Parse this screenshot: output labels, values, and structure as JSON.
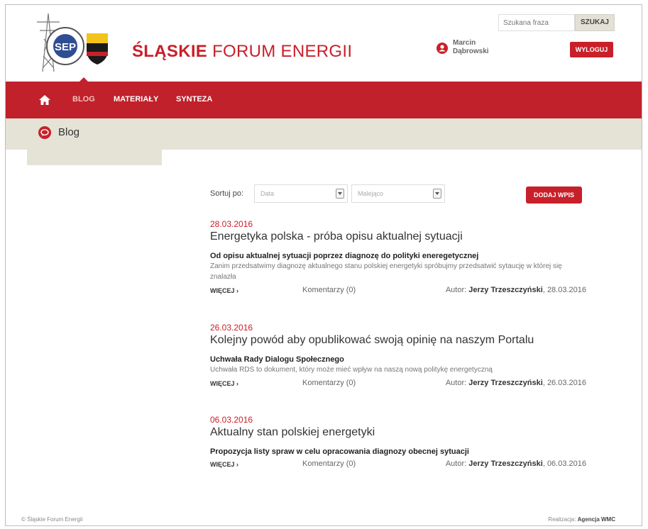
{
  "header": {
    "title_bold": "ŚLĄSKIE",
    "title_rest": " FORUM ENERGII",
    "search_placeholder": "Szukana fraza",
    "search_button": "SZUKAJ",
    "user_first": "Marcin",
    "user_last": "Dąbrowski",
    "logout_button": "WYLOGUJ"
  },
  "nav": {
    "home_icon": "home-icon",
    "items": [
      {
        "label": "BLOG"
      },
      {
        "label": "MATERIAŁY"
      },
      {
        "label": "SYNTEZA"
      }
    ]
  },
  "breadcrumb": {
    "title": "Blog",
    "icon": "speech-bubble-icon"
  },
  "sort": {
    "label": "Sortuj po:",
    "field_value": "Data",
    "order_value": "Malejąco",
    "add_button": "DODAJ WPIS"
  },
  "posts": [
    {
      "date": "28.03.2016",
      "title": "Energetyka polska - próba opisu aktualnej sytuacji",
      "subtitle": "Od opisu aktualnej sytuacji poprzez diagnozę do polityki eneregetycznej",
      "excerpt": "Zanim przedsatwimy diagnozę aktualnego stanu polskiej energetyki spróbujmy przedsatwić sytaucję w której się znalazła",
      "more": "WIĘCEJ ›",
      "comments": "Komentarzy (0)",
      "author_label": "Autor: ",
      "author_name": "Jerzy Trzeszczyński",
      "author_date": ", 28.03.2016"
    },
    {
      "date": "26.03.2016",
      "title": "Kolejny powód aby opublikować swoją opinię na naszym Portalu",
      "subtitle": "Uchwała Rady Dialogu Społecznego",
      "excerpt": "Uchwała RDS to dokument, który może mieć wpływ na naszą nową politykę energetyczną",
      "more": "WIĘCEJ ›",
      "comments": "Komentarzy (0)",
      "author_label": "Autor: ",
      "author_name": "Jerzy Trzeszczyński",
      "author_date": ", 26.03.2016"
    },
    {
      "date": "06.03.2016",
      "title": "Aktualny stan polskiej energetyki",
      "subtitle": "Propozycja listy spraw w celu opracowania diagnozy obecnej sytuacji",
      "excerpt": "",
      "more": "WIĘCEJ ›",
      "comments": "Komentarzy (0)",
      "author_label": "Autor: ",
      "author_name": "Jerzy Trzeszczyński",
      "author_date": ", 06.03.2016"
    }
  ],
  "footer": {
    "copyright": "© Śląskie Forum Energii",
    "realization_label": "Realizacja: ",
    "realization_name": "Agencja WMC"
  },
  "colors": {
    "brand_red": "#c8202a",
    "band": "#e5e2d6"
  }
}
